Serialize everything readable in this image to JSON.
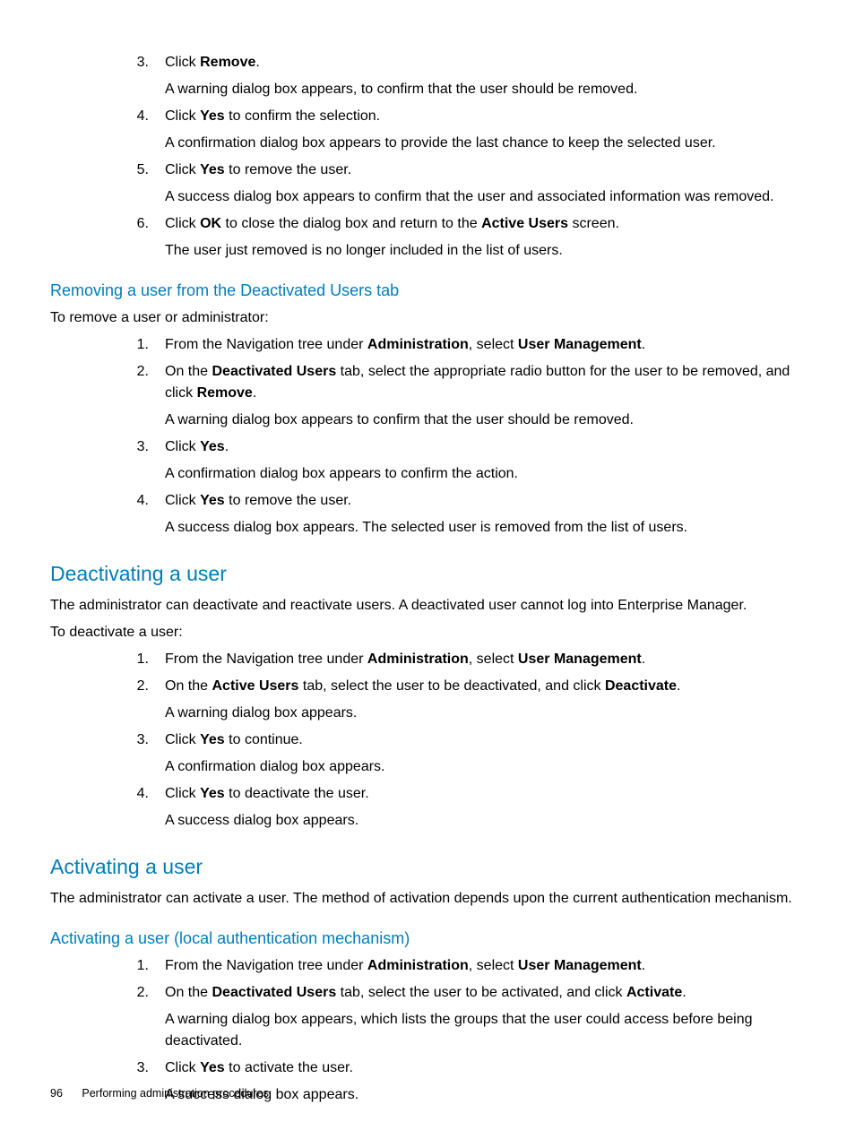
{
  "top_list": [
    {
      "num": "3.",
      "lines": [
        "Click <b>Remove</b>.",
        "A warning dialog box appears, to confirm that the user should be removed."
      ]
    },
    {
      "num": "4.",
      "lines": [
        "Click <b>Yes</b> to confirm the selection.",
        "A confirmation dialog box appears to provide the last chance to keep the selected user."
      ]
    },
    {
      "num": "5.",
      "lines": [
        "Click <b>Yes</b> to remove the user.",
        "A success dialog box appears to confirm that the user and associated information was removed."
      ]
    },
    {
      "num": "6.",
      "lines": [
        "Click <b>OK</b> to close the dialog box and return to the <b>Active Users</b> screen.",
        "The user just removed is no longer included in the list of users."
      ]
    }
  ],
  "sec_remove_deact": {
    "heading": "Removing a user from the Deactivated Users tab",
    "intro": "To remove a user or administrator:",
    "items": [
      {
        "num": "1.",
        "lines": [
          "From the Navigation tree under <b>Administration</b>, select <b>User Management</b>."
        ]
      },
      {
        "num": "2.",
        "lines": [
          "On the <b>Deactivated Users</b> tab, select the appropriate radio button for the user to be removed, and click <b>Remove</b>.",
          "A warning dialog box appears to confirm that the user should be removed."
        ]
      },
      {
        "num": "3.",
        "lines": [
          "Click <b>Yes</b>.",
          "A confirmation dialog box appears to confirm the action."
        ]
      },
      {
        "num": "4.",
        "lines": [
          "Click <b>Yes</b> to remove the user.",
          "A success dialog box appears. The selected user is removed from the list of users."
        ]
      }
    ]
  },
  "sec_deactivate": {
    "heading": "Deactivating a user",
    "intro1": "The administrator can deactivate and reactivate users. A deactivated user cannot log into Enterprise Manager.",
    "intro2": "To deactivate a user:",
    "items": [
      {
        "num": "1.",
        "lines": [
          "From the Navigation tree under <b>Administration</b>, select <b>User Management</b>."
        ]
      },
      {
        "num": "2.",
        "lines": [
          "On the <b>Active Users</b> tab, select the user to be deactivated, and click <b>Deactivate</b>.",
          "A warning dialog box appears."
        ]
      },
      {
        "num": "3.",
        "lines": [
          "Click <b>Yes</b> to continue.",
          "A confirmation dialog box appears."
        ]
      },
      {
        "num": "4.",
        "lines": [
          "Click <b>Yes</b> to deactivate the user.",
          "A success dialog box appears."
        ]
      }
    ]
  },
  "sec_activate": {
    "heading": "Activating a user",
    "intro": "The administrator can activate a user. The method of activation depends upon the current authentication mechanism."
  },
  "sec_activate_local": {
    "heading": "Activating a user (local authentication mechanism)",
    "items": [
      {
        "num": "1.",
        "lines": [
          "From the Navigation tree under <b>Administration</b>, select <b>User Management</b>."
        ]
      },
      {
        "num": "2.",
        "lines": [
          "On the <b>Deactivated Users</b> tab, select the user to be activated, and click <b>Activate</b>.",
          "A warning dialog box appears, which lists the groups that the user could access before being deactivated."
        ]
      },
      {
        "num": "3.",
        "lines": [
          "Click <b>Yes</b> to activate the user.",
          "A success dialog box appears."
        ]
      }
    ]
  },
  "footer": {
    "page": "96",
    "title": "Performing administration procedures"
  }
}
